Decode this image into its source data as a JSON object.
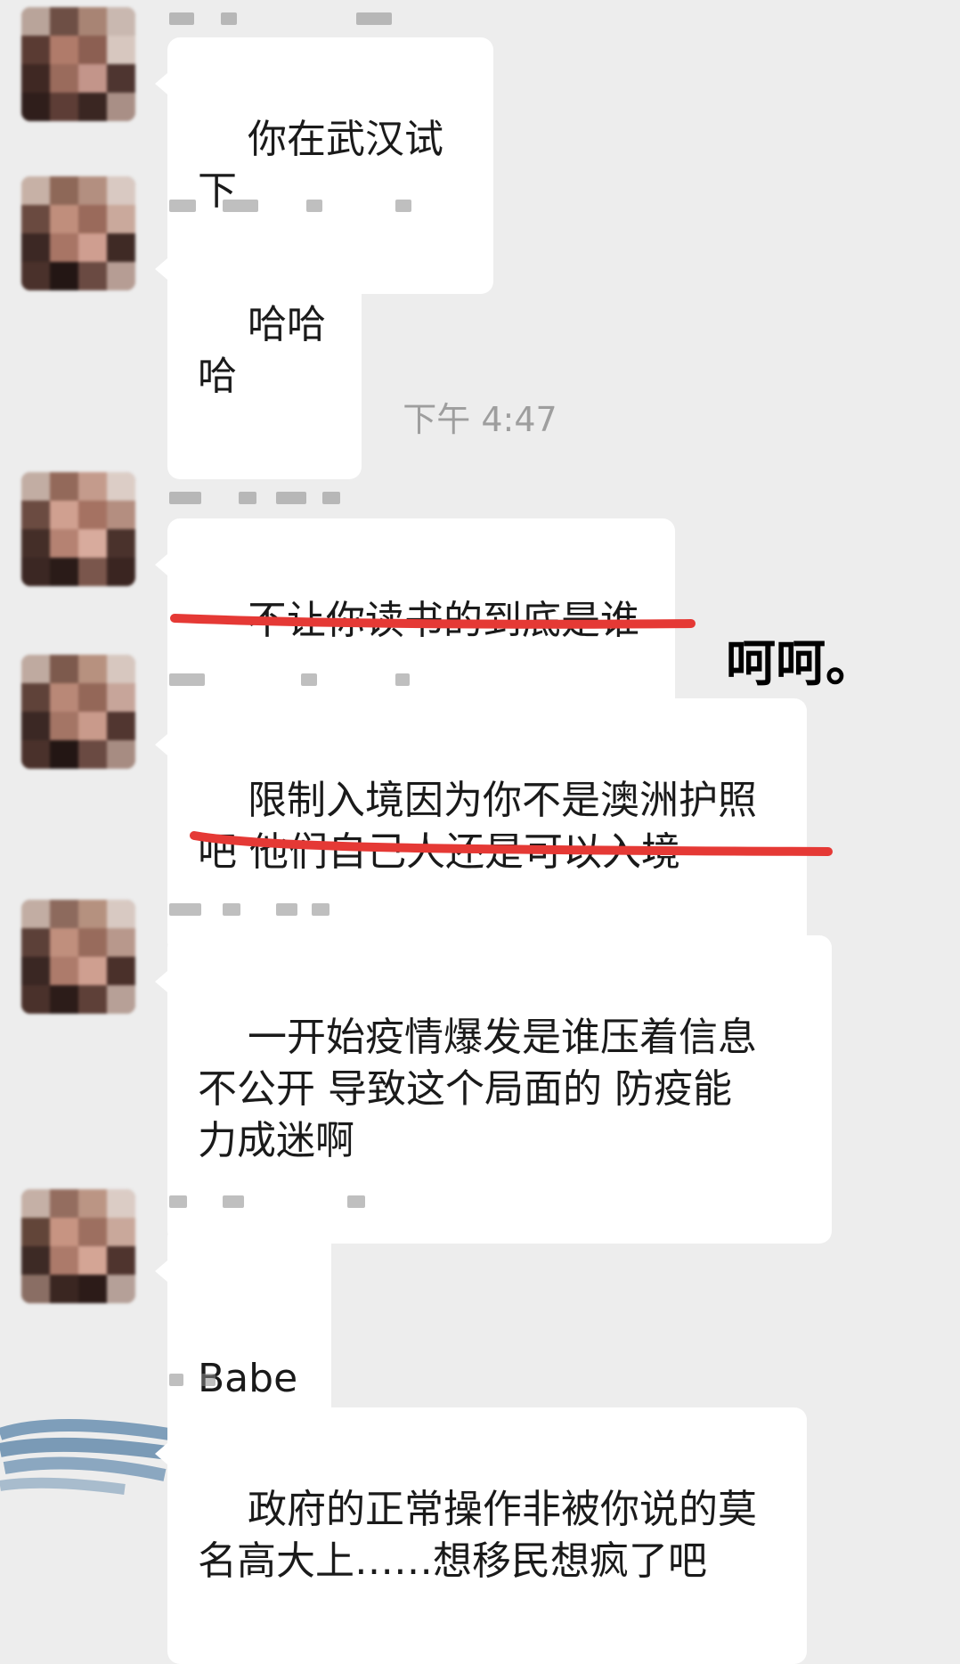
{
  "timestamp": "下午 4:47",
  "annotation": "呵呵。",
  "messages": [
    {
      "text": "你在武汉试下"
    },
    {
      "text": "哈哈哈"
    },
    {
      "text": "不让你读书的到底是谁"
    },
    {
      "text": "限制入境因为你不是澳洲护照\n吧 他们自己人还是可以入境"
    },
    {
      "text": "一开始疫情爆发是谁压着信息\n不公开 导致这个局面的 防疫能\n力成迷啊"
    },
    {
      "text": "Babe"
    },
    {
      "text": "政府的正常操作非被你说的莫\n名高大上……想移民想疯了吧"
    }
  ],
  "colors": {
    "background": "#ededed",
    "bubble": "#ffffff",
    "underline": "#e53935",
    "scribble": "#6a8fb0"
  }
}
